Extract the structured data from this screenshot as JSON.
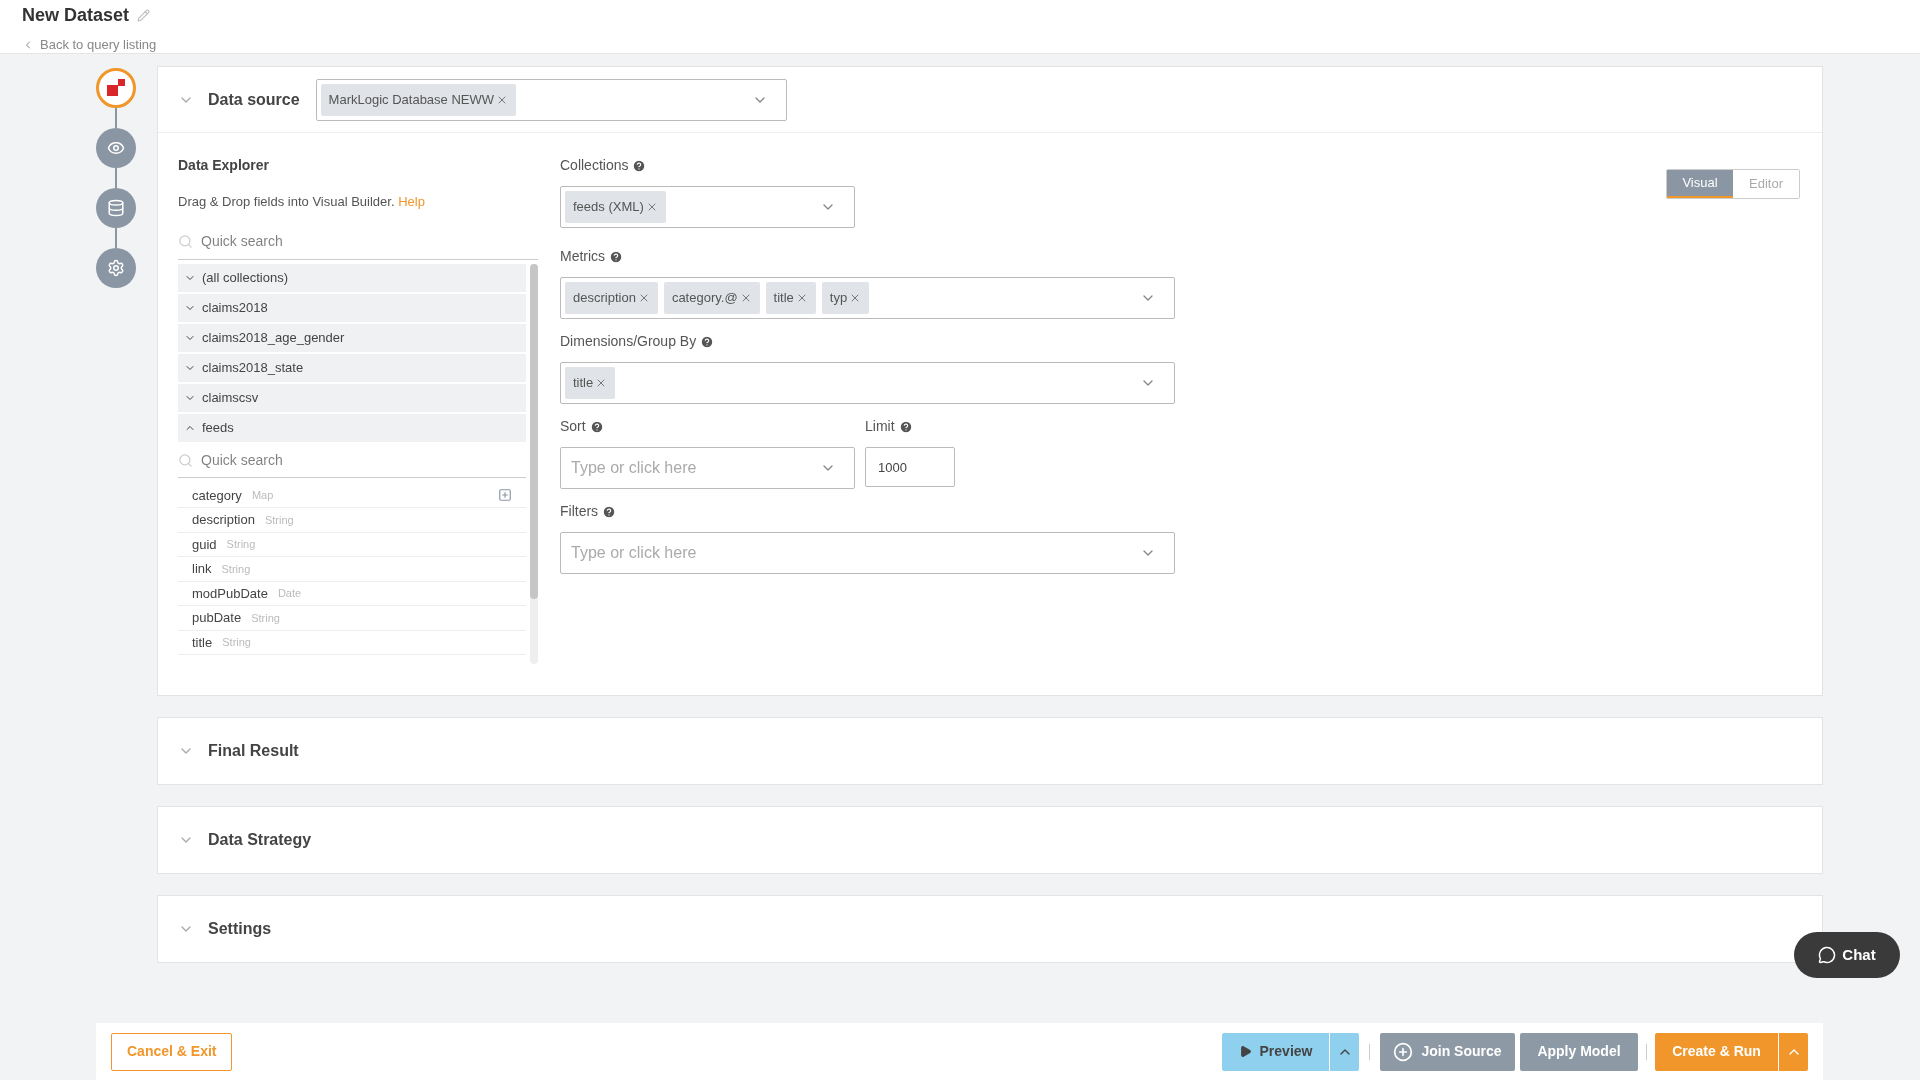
{
  "header": {
    "title": "New Dataset",
    "back_link": "Back to query listing"
  },
  "stepper": [
    {
      "kind": "logo",
      "selected": true
    },
    {
      "kind": "preview",
      "selected": false
    },
    {
      "kind": "data",
      "selected": false
    },
    {
      "kind": "settings",
      "selected": false
    }
  ],
  "data_source": {
    "title": "Data source",
    "expanded": true,
    "tags": [
      "MarkLogic Database NEWW"
    ]
  },
  "explorer": {
    "title": "Data Explorer",
    "hint": "Drag & Drop fields into Visual Builder.",
    "help_link": "Help",
    "search": {
      "placeholder": "Quick search"
    },
    "collections": [
      {
        "name": "(all collections)",
        "expanded": false
      },
      {
        "name": "claims2018",
        "expanded": false
      },
      {
        "name": "claims2018_age_gender",
        "expanded": false
      },
      {
        "name": "claims2018_state",
        "expanded": false
      },
      {
        "name": "claimscsv",
        "expanded": false
      },
      {
        "name": "feeds",
        "expanded": true
      }
    ],
    "field_search": {
      "placeholder": "Quick search"
    },
    "fields": [
      {
        "name": "category",
        "type": "Map"
      },
      {
        "name": "description",
        "type": "String"
      },
      {
        "name": "guid",
        "type": "String"
      },
      {
        "name": "link",
        "type": "String"
      },
      {
        "name": "modPubDate",
        "type": "Date"
      },
      {
        "name": "pubDate",
        "type": "String"
      },
      {
        "name": "title",
        "type": "String"
      }
    ]
  },
  "mode_tabs": [
    {
      "label": "Visual",
      "selected": true
    },
    {
      "label": "Editor",
      "selected": false
    }
  ],
  "form": {
    "collections": {
      "label": "Collections",
      "tags": [
        "feeds (XML)"
      ]
    },
    "metrics": {
      "label": "Metrics",
      "tags": [
        "description",
        "category.@",
        "title",
        "typ"
      ]
    },
    "dimensions": {
      "label": "Dimensions/Group By",
      "tags": [
        "title"
      ]
    },
    "sort": {
      "label": "Sort",
      "placeholder": "Type or click here"
    },
    "limit": {
      "label": "Limit",
      "value": "1000"
    },
    "filters": {
      "label": "Filters",
      "placeholder": "Type or click here"
    }
  },
  "sections": [
    {
      "title": "Final Result",
      "expanded": false
    },
    {
      "title": "Data Strategy",
      "expanded": false
    },
    {
      "title": "Settings",
      "expanded": false
    }
  ],
  "chat_button": "Chat",
  "footer": {
    "cancel": "Cancel & Exit",
    "preview": "Preview",
    "join": "Join Source",
    "apply": "Apply Model",
    "create": "Create & Run"
  }
}
